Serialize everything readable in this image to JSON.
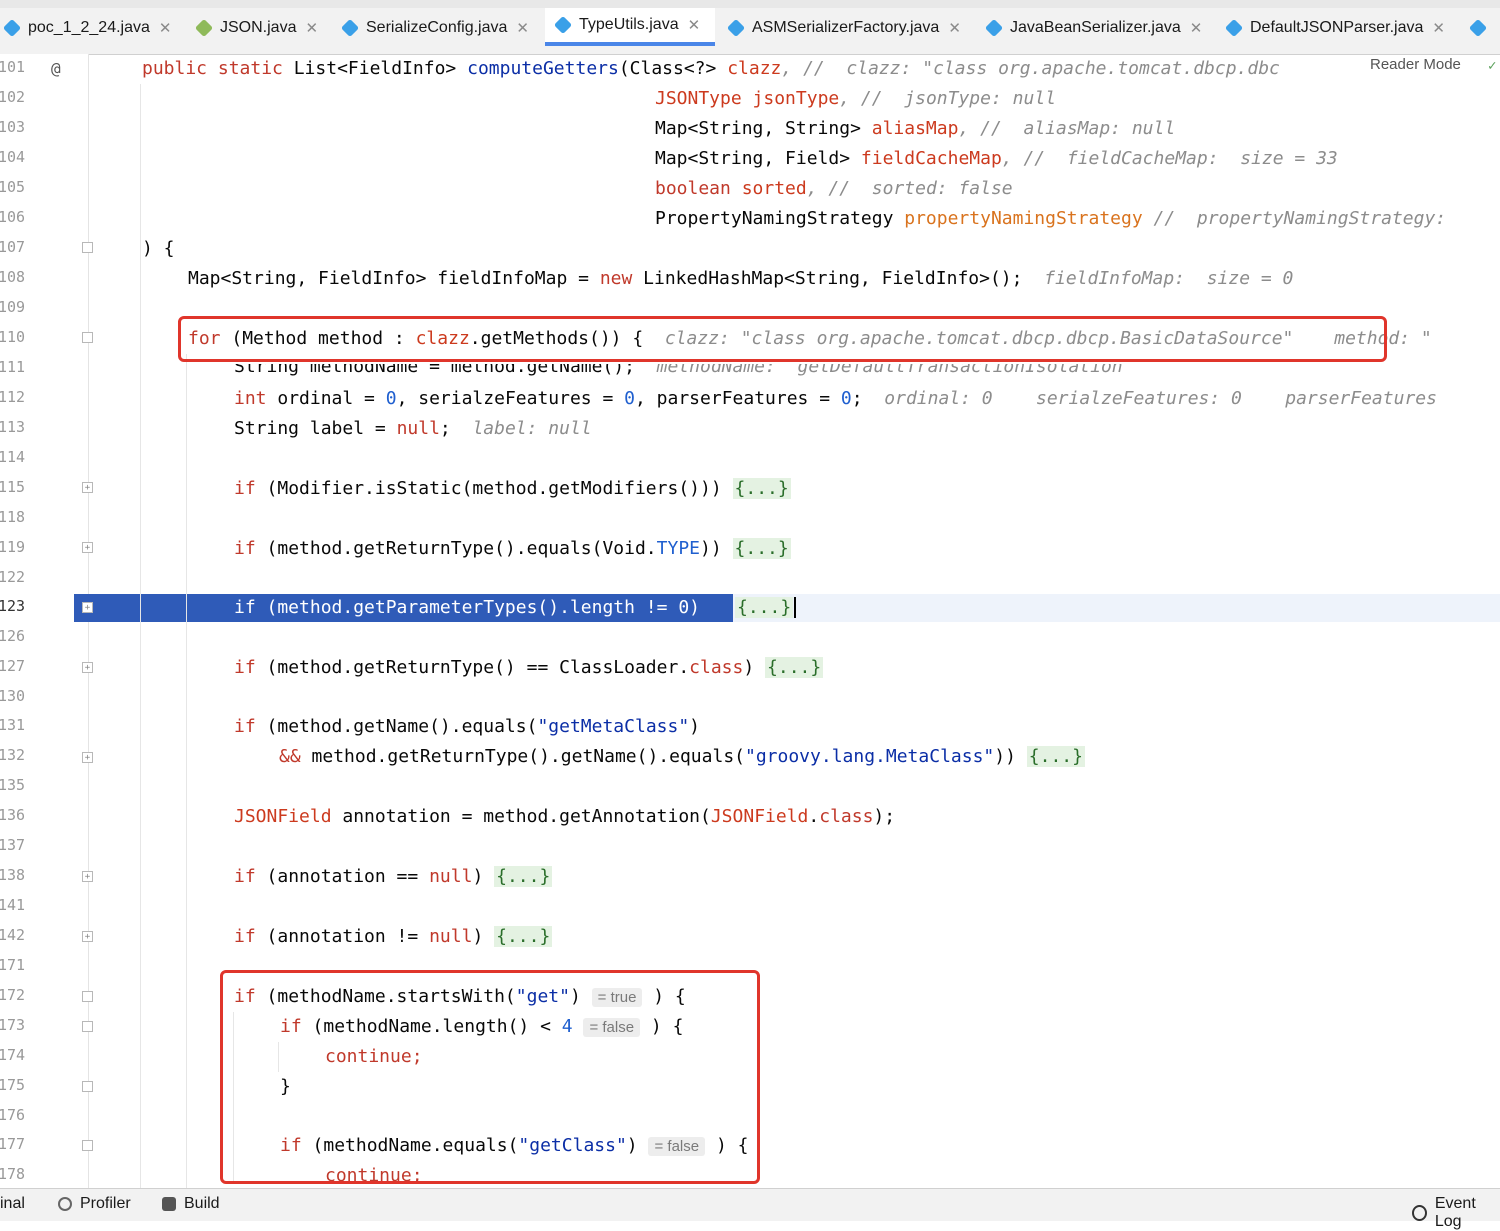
{
  "tabs": [
    {
      "label": "poc_1_2_24.java",
      "icon": "java-class-icon"
    },
    {
      "label": "JSON.java",
      "icon": "java-class-icon"
    },
    {
      "label": "SerializeConfig.java",
      "icon": "java-class-icon"
    },
    {
      "label": "TypeUtils.java",
      "icon": "java-class-icon",
      "active": true
    },
    {
      "label": "ASMSerializerFactory.java",
      "icon": "java-class-icon"
    },
    {
      "label": "JavaBeanSerializer.java",
      "icon": "java-class-icon"
    },
    {
      "label": "DefaultJSONParser.java",
      "icon": "java-class-icon"
    }
  ],
  "editor": {
    "reader_mode": "Reader Mode",
    "line_numbers": [
      "101",
      "102",
      "103",
      "104",
      "105",
      "106",
      "107",
      "108",
      "109",
      "110",
      "111",
      "112",
      "113",
      "114",
      "115",
      "118",
      "119",
      "122",
      "123",
      "126",
      "127",
      "130",
      "131",
      "132",
      "135",
      "136",
      "137",
      "138",
      "141",
      "142",
      "171",
      "172",
      "173",
      "174",
      "175",
      "176",
      "177",
      "178"
    ],
    "lines": {
      "l101_a": "public static ",
      "l101_b": "List<FieldInfo> ",
      "l101_c": "computeGetters",
      "l101_d": "(Class<?> ",
      "l101_e": "clazz",
      "l101_f": ", // ",
      "l101_hint": " clazz: \"class org.apache.tomcat.dbcp.dbc",
      "l102_a": "JSONType ",
      "l102_b": "jsonType",
      "l102_c": ", // ",
      "l102_hint": " jsonType: null",
      "l103_a": "Map<String, String> ",
      "l103_b": "aliasMap",
      "l103_c": ", // ",
      "l103_hint": " aliasMap: null",
      "l104_a": "Map<String, Field> ",
      "l104_b": "fieldCacheMap",
      "l104_c": ", // ",
      "l104_hint": " fieldCacheMap:  size = 33",
      "l105_a": "boolean ",
      "l105_b": "sorted",
      "l105_c": ", // ",
      "l105_hint": " sorted: false",
      "l106_a": "PropertyNamingStrategy ",
      "l106_b": "propertyNamingStrategy",
      "l106_c": " // ",
      "l106_hint": " propertyNamingStrategy:",
      "l107": ") {",
      "l108_a": "Map<String, FieldInfo> fieldInfoMap = ",
      "l108_b": "new ",
      "l108_c": "LinkedHashMap<String, FieldInfo>();",
      "l108_hint": "  fieldInfoMap:  size = 0",
      "l110_a": "for ",
      "l110_b": "(Method method : ",
      "l110_c": "clazz",
      "l110_d": ".getMethods()) {",
      "l110_hint": "  clazz: \"class org.apache.tomcat.dbcp.dbcp.BasicDataSource\"",
      "l110_hint2": " method: \"",
      "l111_a": "String methodName = method.getName();",
      "l111_hint": "  methodName: \"getDefaultTransactionIsolation\"",
      "l112_a": "int ",
      "l112_b": "ordinal = ",
      "l112_c": "0",
      "l112_d": ", serialzeFeatures = ",
      "l112_e": "0",
      "l112_f": ", parserFeatures = ",
      "l112_g": "0",
      "l112_h": ";",
      "l112_hint": "  ordinal: 0    serialzeFeatures: 0    parserFeatures",
      "l113_a": "String label = ",
      "l113_b": "null",
      "l113_c": ";",
      "l113_hint": "  label: null",
      "l115_a": "if ",
      "l115_b": "(Modifier.isStatic(method.getModifiers())) ",
      "fold_chip": "{...}",
      "l119_a": "if ",
      "l119_b": "(method.getReturnType().equals(Void.",
      "l119_c": "TYPE",
      "l119_d": ")) ",
      "l123_a": "if (method.getParameterTypes().length != 0)",
      "l127_a": "if ",
      "l127_b": "(method.getReturnType() == ClassLoader.",
      "l127_c": "class",
      "l127_d": ") ",
      "l131_a": "if ",
      "l131_b": "(method.getName().equals(",
      "l131_c": "\"getMetaClass\"",
      "l131_d": ")",
      "l132_a": "&& ",
      "l132_b": "method.getReturnType().getName().equals(",
      "l132_c": "\"groovy.lang.MetaClass\"",
      "l132_d": ")) ",
      "l136_a": "JSONField ",
      "l136_b": "annotation = method.getAnnotation(",
      "l136_c": "JSONField",
      "l136_d": ".",
      "l136_e": "class",
      "l136_f": ");",
      "l138_a": "if ",
      "l138_b": "(annotation == ",
      "l138_c": "null",
      "l138_d": ") ",
      "l142_a": "if ",
      "l142_b": "(annotation != ",
      "l142_c": "null",
      "l142_d": ") ",
      "l172_a": "if ",
      "l172_b": "(methodName.startsWith(",
      "l172_c": "\"get\"",
      "l172_d": ")",
      "l172_inlay": "= true",
      "l172_e": " ) {",
      "l173_a": "if ",
      "l173_b": "(methodName.length() < ",
      "l173_c": "4",
      "l173_inlay": "= false",
      "l173_e": " ) {",
      "l174": "continue;",
      "l175": "}",
      "l177_a": "if ",
      "l177_b": "(methodName.equals(",
      "l177_c": "\"getClass\"",
      "l177_d": ")",
      "l177_inlay": "= false",
      "l177_e": " ) {",
      "l178": "continue;"
    }
  },
  "bottom_bar": {
    "terminal": "inal",
    "profiler": "Profiler",
    "build": "Build",
    "event_log": "Event Log"
  }
}
